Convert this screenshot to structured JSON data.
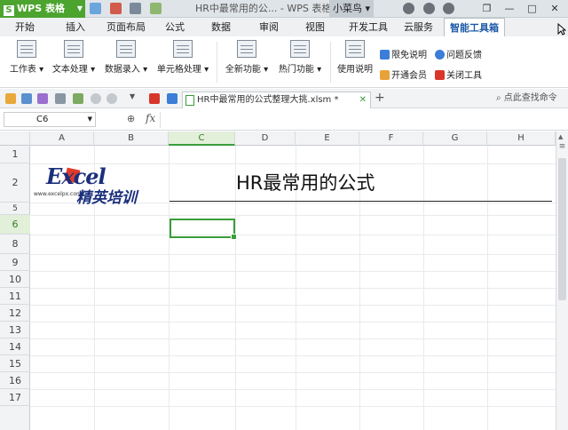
{
  "app": {
    "name": "WPS 表格"
  },
  "window": {
    "title": "HR中最常用的公... - WPS 表格",
    "user": "小菜鸟"
  },
  "menu": {
    "tabs": [
      "开始",
      "插入",
      "页面布局",
      "公式",
      "数据",
      "审阅",
      "视图",
      "开发工具",
      "云服务",
      "智能工具箱"
    ],
    "active": "智能工具箱"
  },
  "ribbon": {
    "buttons": [
      {
        "label": "工作表"
      },
      {
        "label": "文本处理"
      },
      {
        "label": "数据录入"
      },
      {
        "label": "单元格处理"
      },
      {
        "label": "全新功能"
      },
      {
        "label": "热门功能"
      },
      {
        "label": "使用说明"
      }
    ],
    "small": [
      {
        "label": "限免说明",
        "icon": "tag-icon",
        "color": "#3b7dd8"
      },
      {
        "label": "问题反馈",
        "icon": "help-icon",
        "color": "#3b7dd8"
      },
      {
        "label": "开通会员",
        "icon": "crown-icon",
        "color": "#e8a23a"
      },
      {
        "label": "关闭工具",
        "icon": "close-icon",
        "color": "#d9362b"
      }
    ]
  },
  "doc_tab": {
    "filename": "HR中最常用的公式整理大挑.xlsm *"
  },
  "search": {
    "placeholder": "点此查找命令"
  },
  "formula_bar": {
    "name_box": "C6",
    "fx": "fx",
    "formula": ""
  },
  "sheet": {
    "columns": [
      "A",
      "B",
      "C",
      "D",
      "E",
      "F",
      "G",
      "H"
    ],
    "rows": [
      "1",
      "2",
      "5",
      "6",
      "8",
      "9",
      "10",
      "11",
      "12",
      "13",
      "14",
      "15",
      "16",
      "17"
    ],
    "selected_column": "C",
    "selected_row": "6",
    "logo": {
      "brand": "Excel",
      "url": "www.excelpx.com",
      "cn": "精英培训"
    },
    "heading": "HR最常用的公式"
  }
}
